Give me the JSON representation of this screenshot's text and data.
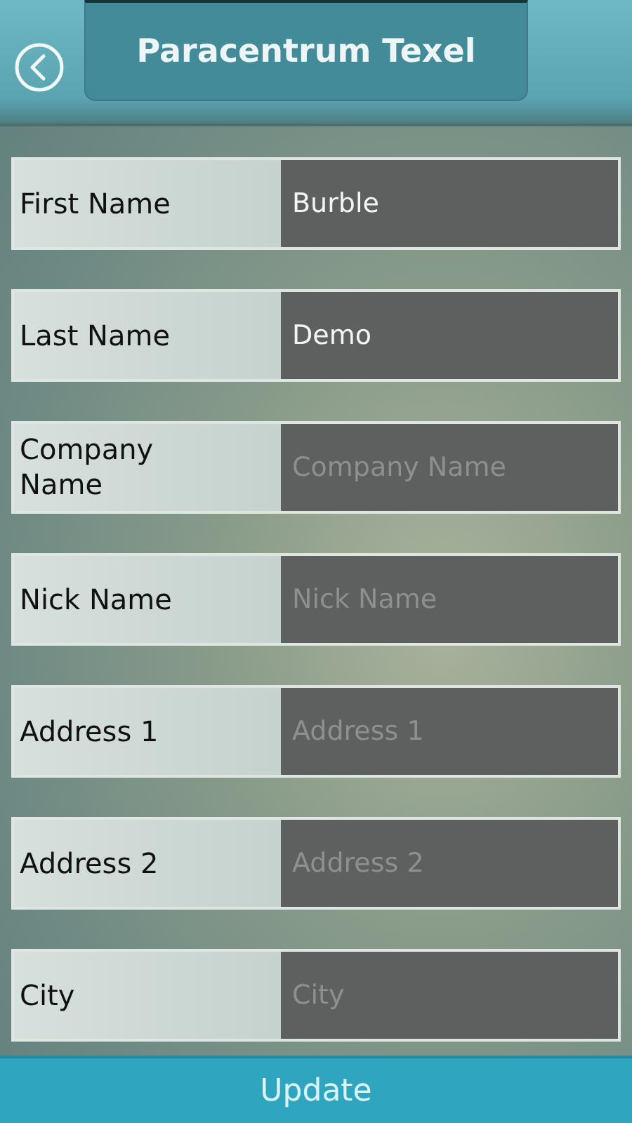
{
  "header": {
    "title": "Paracentrum Texel"
  },
  "fields": [
    {
      "label": "First Name",
      "value": "Burble"
    },
    {
      "label": "Last Name",
      "value": "Demo"
    },
    {
      "label": "Company Name",
      "placeholder": "Company Name"
    },
    {
      "label": "Nick Name",
      "placeholder": "Nick Name"
    },
    {
      "label": "Address 1",
      "placeholder": "Address 1"
    },
    {
      "label": "Address 2",
      "placeholder": "Address 2"
    },
    {
      "label": "City",
      "placeholder": "City"
    }
  ],
  "footer": {
    "button": "Update"
  }
}
